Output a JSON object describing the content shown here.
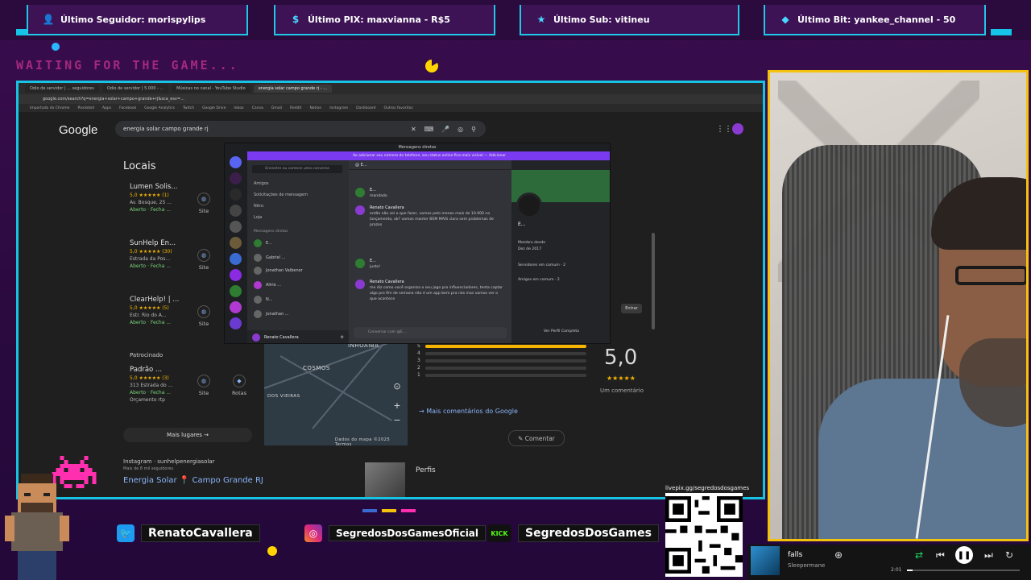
{
  "alerts": [
    {
      "icon": "user-icon",
      "text": "Último Seguidor: morispylips"
    },
    {
      "icon": "pix-icon",
      "text": "Último PIX: maxvianna - R$5"
    },
    {
      "icon": "star-icon",
      "text": "Último Sub: vitineu"
    },
    {
      "icon": "gem-icon",
      "text": "Último Bit: yankee_channel - 50"
    }
  ],
  "waiting_text": "WAITING FOR THE GAME...",
  "browser": {
    "tabs": [
      "Odio de servidor | ... seguidores",
      "Odio de servidor | 5.000 - ...",
      "Músicas no canal - YouTube Studio",
      "energia solar campo grande rj - ..."
    ],
    "url": "google.com/search?q=energia+solar+campo+grande+rj&sca_esv=...",
    "bookmarks": [
      "Importado do Chrome",
      "Pixelated",
      "Apps",
      "Facebook",
      "Google Analytics",
      "Twitch",
      "Google Drive",
      "Inbox",
      "Canva",
      "Gmail",
      "Reddit",
      "Notion",
      "Instagram",
      "Dashboard",
      "Outros favoritos"
    ]
  },
  "google": {
    "logo": "Google",
    "query": "energia solar campo grande rj",
    "locais_title": "Locais",
    "places": [
      {
        "name": "Lumen Solis...",
        "rating": "5,0 ★★★★★ (1)",
        "address": "Av. Bosque, 25 ...",
        "status": "Aberto · Fecha ...",
        "action": "Site"
      },
      {
        "name": "SunHelp En...",
        "rating": "5,0 ★★★★★ (30)",
        "address": "Estrada da Pos...",
        "status": "Aberto · Fecha ...",
        "action": "Site"
      },
      {
        "name": "ClearHelp! | ...",
        "rating": "5,0 ★★★★★ (5)",
        "address": "Estr. Rio do A...",
        "status": "Aberto · Fecha ...",
        "action": "Site"
      }
    ],
    "patrocinado": "Patrocinado",
    "sponsored": {
      "name": "Padrão ...",
      "rating": "5,0 ★★★★★ (3)",
      "address": "313 Estrada do ...",
      "status": "Aberto · Fecha ...",
      "extra": "Orçamento rtp",
      "action_site": "Site",
      "action_route": "Rotas"
    },
    "mais_lugares": "Mais lugares →",
    "instagram": {
      "handle": "Instagram · sunhelpenergiasolar",
      "sub": "Mais de 8 mil seguidores",
      "title": "Energia Solar 📍 Campo Grande RJ"
    },
    "map": {
      "labels": [
        "INHOAIBA",
        "COSMOS",
        "DOS VIEIRAS"
      ],
      "footer": "Dados do mapa ©2025  Termos"
    },
    "reviews": {
      "score": "5,0",
      "stars": "★★★★★",
      "count": "Um comentário",
      "rows": [
        {
          "label": "5",
          "fill": 1
        },
        {
          "label": "4",
          "fill": 0
        },
        {
          "label": "3",
          "fill": 0
        },
        {
          "label": "2",
          "fill": 0
        },
        {
          "label": "1",
          "fill": 0
        }
      ]
    },
    "mais_comentarios": "Mais comentários do Google",
    "comentar": "Comentar",
    "perfis": "Perfis",
    "entrar": "Entrar"
  },
  "discord": {
    "title": "Mensagens diretas",
    "banner": "Ao adicionar seu número de telefone, seu status online fica mais visível — Adicionar",
    "search": "Encontre ou comece uma conversa",
    "nav": [
      "Amigos",
      "Solicitações de mensagem",
      "Nitro",
      "Loja"
    ],
    "dm_header": "Mensagens diretas",
    "dms": [
      "E...",
      "Gabriel ...",
      "Jonathan Valbenor",
      "Alirio ...",
      "N...",
      "Jonathan ..."
    ],
    "user": "Renato Cavallera",
    "chat_title": "E...",
    "messages": [
      {
        "author": "E...",
        "text": "mandado"
      },
      {
        "author": "Renato Cavallera",
        "text": "então não sei o que fazer, vamos pelo menos mais de 10.000 no lançamento, ok? vamos manter BEM MAIS clara sem problemas de prazos"
      },
      {
        "author": "E...",
        "text": "justo!"
      },
      {
        "author": "Renato Cavallera",
        "text": "me diz como você organiza o seu jogo pra influenciadores, tenta captar algo pro fim de semana não é um app bem pra nós mas vamos ver o que acontece"
      }
    ],
    "input": "Conversar com @E...",
    "profile": {
      "name": "E...",
      "member_label": "Membro desde",
      "member_since": "Dez de 2017",
      "servers": "Servidores em comum · 2",
      "friends": "Amigos em comum · 2",
      "full": "Ver Perfil Completo"
    }
  },
  "social": [
    {
      "icon": "twitter-icon",
      "text": "RenatoCavallera"
    },
    {
      "icon": "instagram-icon",
      "text": "SegredosDosGamesOficial"
    },
    {
      "icon": "kick-icon",
      "text": "SegredosDosGames"
    }
  ],
  "qr_label": "livepix.gg/segredosdosgames",
  "player": {
    "song": "falls",
    "artist": "Sleepermane",
    "time": "2:01",
    "progress": 0.05
  },
  "colors": {
    "accent": "#15c4e6",
    "webcam_border": "#f4c20d",
    "discord_purple": "#7a3bf0"
  }
}
